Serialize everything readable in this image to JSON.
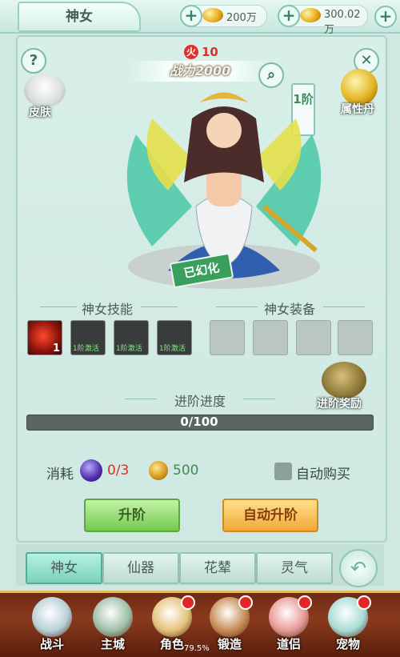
{
  "header": {
    "title": "神女",
    "currencies": [
      {
        "icon": "gold-ingot-icon",
        "value": "200万"
      },
      {
        "icon": "bound-gold-icon",
        "value": "300.02万"
      }
    ]
  },
  "hero": {
    "power_label": "战力2000",
    "fire_level": "10",
    "rank": "1阶",
    "skin_label": "皮肤",
    "attr_label": "属性丹",
    "illusion_stamp": "已幻化"
  },
  "skills": {
    "title": "神女技能",
    "items": [
      {
        "level": "1",
        "note": ""
      },
      {
        "level": "",
        "note": "1阶激活"
      },
      {
        "level": "",
        "note": "1阶激活"
      },
      {
        "level": "",
        "note": "1阶激活"
      }
    ]
  },
  "equipment": {
    "title": "神女装备",
    "items": [
      "lotus-crown-icon",
      "scepter-icon",
      "jade-ring-icon",
      "necklace-icon"
    ]
  },
  "progress": {
    "label": "进阶进度",
    "text": "0/100",
    "fraction": 0,
    "reward_label": "进阶奖励"
  },
  "cost": {
    "label": "消耗",
    "item_count": "0/3",
    "gold": "500",
    "auto_buy_label": "自动购买"
  },
  "buttons": {
    "upgrade": "升阶",
    "auto_upgrade": "自动升阶"
  },
  "tabs": [
    "神女",
    "仙器",
    "花辇",
    "灵气"
  ],
  "nav": [
    {
      "label": "战斗",
      "dot": false,
      "color": "#b8d0d6"
    },
    {
      "label": "主城",
      "dot": false,
      "color": "#9fbfa8"
    },
    {
      "label": "角色",
      "dot": true,
      "color": "#e4c27a"
    },
    {
      "label": "锻造",
      "dot": true,
      "color": "#c88c54"
    },
    {
      "label": "道侣",
      "dot": true,
      "color": "#e89a96"
    },
    {
      "label": "宠物",
      "dot": true,
      "color": "#a8dcd4"
    }
  ],
  "footer_pct": "79.5%",
  "colors": {
    "accent": "#7dd3a0",
    "power_red": "#d8322b"
  }
}
